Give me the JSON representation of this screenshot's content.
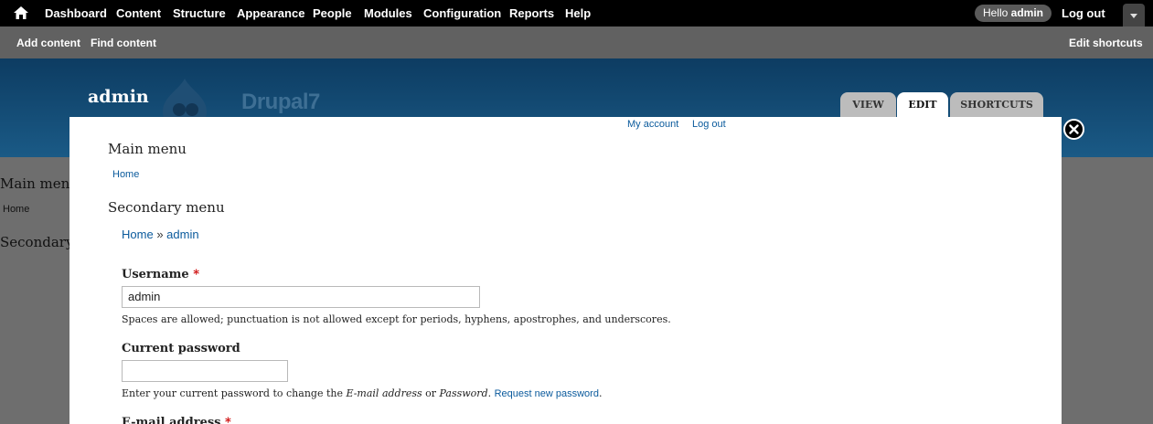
{
  "toolbar": {
    "items": [
      "Dashboard",
      "Content",
      "Structure",
      "Appearance",
      "People",
      "Modules",
      "Configuration",
      "Reports",
      "Help"
    ],
    "hello_prefix": "Hello",
    "user": "admin",
    "logout": "Log out"
  },
  "shortcuts": {
    "add_content": "Add content",
    "find_content": "Find content",
    "edit_shortcuts": "Edit shortcuts"
  },
  "header": {
    "site_name": "admin",
    "logo_text": "Drupal7",
    "tabs": [
      "VIEW",
      "EDIT",
      "SHORTCUTS"
    ]
  },
  "background": {
    "main_menu": "Main menu",
    "home": "Home",
    "secondary": "Secondary"
  },
  "overlay": {
    "links": {
      "my_account": "My account",
      "log_out": "Log out"
    },
    "main_menu_heading": "Main menu",
    "main_menu_home": "Home",
    "secondary_menu_heading": "Secondary menu",
    "breadcrumb": {
      "home": "Home",
      "sep": "»",
      "current": "admin"
    },
    "username": {
      "label": "Username",
      "required": "*",
      "value": "admin",
      "description": "Spaces are allowed; punctuation is not allowed except for periods, hyphens, apostrophes, and underscores."
    },
    "current_password": {
      "label": "Current password",
      "value": "",
      "desc_prefix": "Enter your current password to change the ",
      "desc_email": "E-mail address",
      "desc_or": " or ",
      "desc_password": "Password",
      "desc_dot": ". ",
      "desc_link": "Request new password",
      "desc_end": "."
    },
    "email": {
      "label": "E-mail address",
      "required": "*"
    }
  }
}
